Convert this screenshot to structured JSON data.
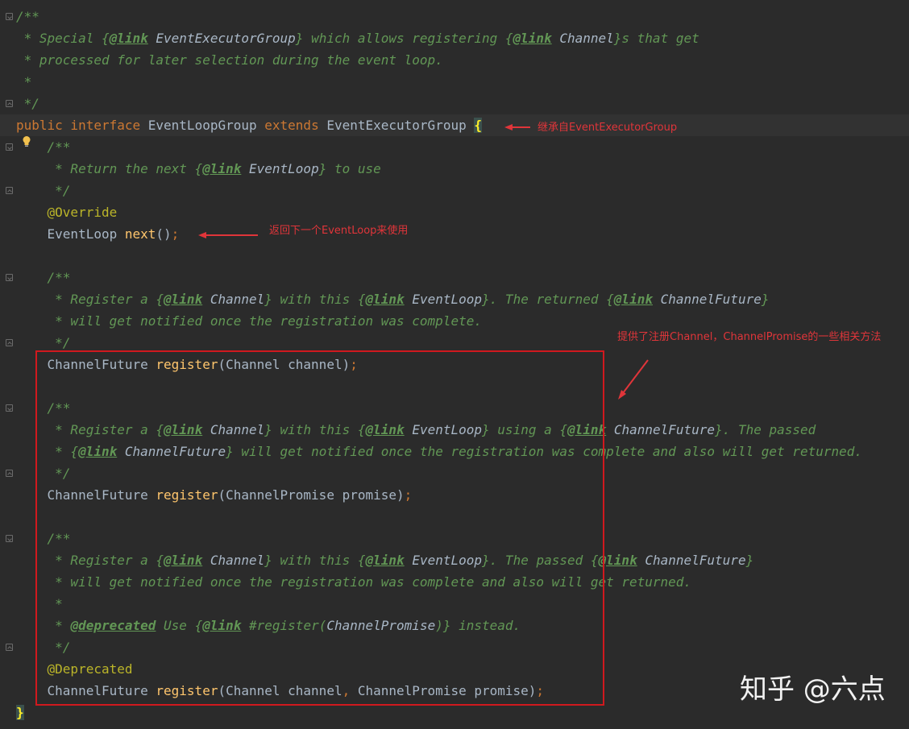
{
  "annotations": {
    "inherit_note": "继承自EventExecutorGroup",
    "next_note": "返回下一个EventLoop来使用",
    "register_note": "提供了注册Channel，ChannelPromise的一些相关方法"
  },
  "watermark": "知乎 @六点",
  "colors": {
    "comment": "#629755",
    "keyword": "#cc7832",
    "annotation": "#bbb529",
    "method": "#ffc66d",
    "identifier": "#a9b7c6",
    "background": "#2b2b2b",
    "markup_red": "#d0191e"
  },
  "code_lines": [
    [
      [
        "doc",
        "/**"
      ]
    ],
    [
      [
        "doc",
        " * Special {"
      ],
      [
        "tag",
        "@link"
      ],
      [
        "doc",
        " "
      ],
      [
        "ref",
        "EventExecutorGroup"
      ],
      [
        "doc",
        "} which allows registering {"
      ],
      [
        "tag",
        "@link"
      ],
      [
        "doc",
        " "
      ],
      [
        "ref",
        "Channel"
      ],
      [
        "doc",
        "}s that get"
      ]
    ],
    [
      [
        "doc",
        " * processed for later selection during the event loop."
      ]
    ],
    [
      [
        "doc",
        " *"
      ]
    ],
    [
      [
        "doc",
        " */"
      ]
    ],
    [
      [
        "kw",
        "public interface "
      ],
      [
        "id",
        "EventLoopGroup "
      ],
      [
        "kw",
        "extends "
      ],
      [
        "id",
        "EventExecutorGroup "
      ],
      [
        "brace",
        "{"
      ]
    ],
    [
      [
        "doc",
        "    /**"
      ]
    ],
    [
      [
        "doc",
        "     * Return the next {"
      ],
      [
        "tag",
        "@link"
      ],
      [
        "doc",
        " "
      ],
      [
        "ref",
        "EventLoop"
      ],
      [
        "doc",
        "} to use"
      ]
    ],
    [
      [
        "doc",
        "     */"
      ]
    ],
    [
      [
        "ann",
        "    @Override"
      ]
    ],
    [
      [
        "id",
        "    EventLoop "
      ],
      [
        "fn",
        "next"
      ],
      [
        "id",
        "()"
      ],
      [
        "kw",
        ";"
      ]
    ],
    [
      [
        "id",
        ""
      ]
    ],
    [
      [
        "doc",
        "    /**"
      ]
    ],
    [
      [
        "doc",
        "     * Register a {"
      ],
      [
        "tag",
        "@link"
      ],
      [
        "doc",
        " "
      ],
      [
        "ref",
        "Channel"
      ],
      [
        "doc",
        "} with this {"
      ],
      [
        "tag",
        "@link"
      ],
      [
        "doc",
        " "
      ],
      [
        "ref",
        "EventLoop"
      ],
      [
        "doc",
        "}. The returned {"
      ],
      [
        "tag",
        "@link"
      ],
      [
        "doc",
        " "
      ],
      [
        "ref",
        "ChannelFuture"
      ],
      [
        "doc",
        "}"
      ]
    ],
    [
      [
        "doc",
        "     * will get notified once the registration was complete."
      ]
    ],
    [
      [
        "doc",
        "     */"
      ]
    ],
    [
      [
        "id",
        "    ChannelFuture "
      ],
      [
        "fn",
        "register"
      ],
      [
        "id",
        "(Channel channel)"
      ],
      [
        "kw",
        ";"
      ]
    ],
    [
      [
        "id",
        ""
      ]
    ],
    [
      [
        "doc",
        "    /**"
      ]
    ],
    [
      [
        "doc",
        "     * Register a {"
      ],
      [
        "tag",
        "@link"
      ],
      [
        "doc",
        " "
      ],
      [
        "ref",
        "Channel"
      ],
      [
        "doc",
        "} with this {"
      ],
      [
        "tag",
        "@link"
      ],
      [
        "doc",
        " "
      ],
      [
        "ref",
        "EventLoop"
      ],
      [
        "doc",
        "} using a {"
      ],
      [
        "tag",
        "@link"
      ],
      [
        "doc",
        " "
      ],
      [
        "ref",
        "ChannelFuture"
      ],
      [
        "doc",
        "}. The passed"
      ]
    ],
    [
      [
        "doc",
        "     * {"
      ],
      [
        "tag",
        "@link"
      ],
      [
        "doc",
        " "
      ],
      [
        "ref",
        "ChannelFuture"
      ],
      [
        "doc",
        "} will get notified once the registration was complete and also will get returned."
      ]
    ],
    [
      [
        "doc",
        "     */"
      ]
    ],
    [
      [
        "id",
        "    ChannelFuture "
      ],
      [
        "fn",
        "register"
      ],
      [
        "id",
        "(ChannelPromise promise)"
      ],
      [
        "kw",
        ";"
      ]
    ],
    [
      [
        "id",
        ""
      ]
    ],
    [
      [
        "doc",
        "    /**"
      ]
    ],
    [
      [
        "doc",
        "     * Register a {"
      ],
      [
        "tag",
        "@link"
      ],
      [
        "doc",
        " "
      ],
      [
        "ref",
        "Channel"
      ],
      [
        "doc",
        "} with this {"
      ],
      [
        "tag",
        "@link"
      ],
      [
        "doc",
        " "
      ],
      [
        "ref",
        "EventLoop"
      ],
      [
        "doc",
        "}. The passed {"
      ],
      [
        "tag",
        "@link"
      ],
      [
        "doc",
        " "
      ],
      [
        "ref",
        "ChannelFuture"
      ],
      [
        "doc",
        "}"
      ]
    ],
    [
      [
        "doc",
        "     * will get notified once the registration was complete and also will get returned."
      ]
    ],
    [
      [
        "doc",
        "     *"
      ]
    ],
    [
      [
        "doc",
        "     * "
      ],
      [
        "tag",
        "@deprecated"
      ],
      [
        "doc",
        " Use {"
      ],
      [
        "tag",
        "@link"
      ],
      [
        "doc",
        " #register("
      ],
      [
        "ref",
        "ChannelPromise"
      ],
      [
        "doc",
        ")} instead."
      ]
    ],
    [
      [
        "doc",
        "     */"
      ]
    ],
    [
      [
        "ann",
        "    @Deprecated"
      ]
    ],
    [
      [
        "id",
        "    ChannelFuture "
      ],
      [
        "fn",
        "register"
      ],
      [
        "id",
        "(Channel channel"
      ],
      [
        "kw",
        ", "
      ],
      [
        "id",
        "ChannelPromise promise)"
      ],
      [
        "kw",
        ";"
      ]
    ],
    [
      [
        "brace",
        "}"
      ]
    ]
  ]
}
